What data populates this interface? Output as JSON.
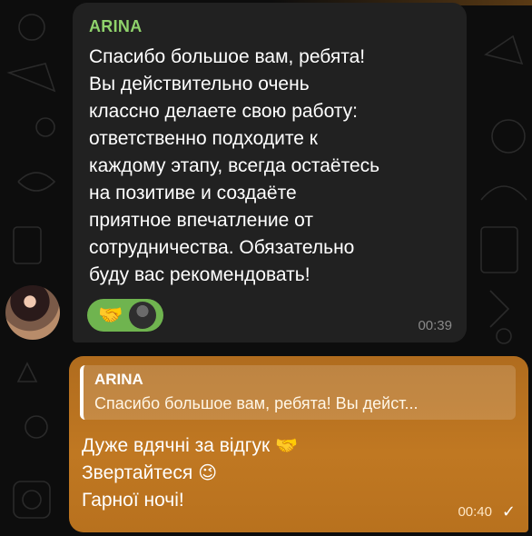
{
  "incoming": {
    "sender": "ARINA",
    "text": "Спасибо большое вам, ребята!\nВы действительно очень\nклассно делаете свою работу:\nответственно подходите к\nкаждому этапу, всегда остаётесь\nна позитиве и создаёте\nприятное впечатление от\nсотрудничества. Обязательно\nбуду вас рекомендовать!",
    "reaction_emoji": "🤝",
    "time": "00:39"
  },
  "outgoing": {
    "quote_sender": "ARINA",
    "quote_text": "Спасибо большое вам, ребята! Вы дейст...",
    "line1": "Дуже вдячні за відгук",
    "line1_emoji": "🤝",
    "line2": "Звертайтеся",
    "line2_emoji": "😉",
    "line3": "Гарної ночі!",
    "time": "00:40",
    "status_icon": "single-check-icon"
  },
  "colors": {
    "incoming_bubble": "#212121",
    "outgoing_bubble": "#c07822",
    "sender_name": "#8fd26b",
    "reaction_pill": "#6fb44f"
  }
}
